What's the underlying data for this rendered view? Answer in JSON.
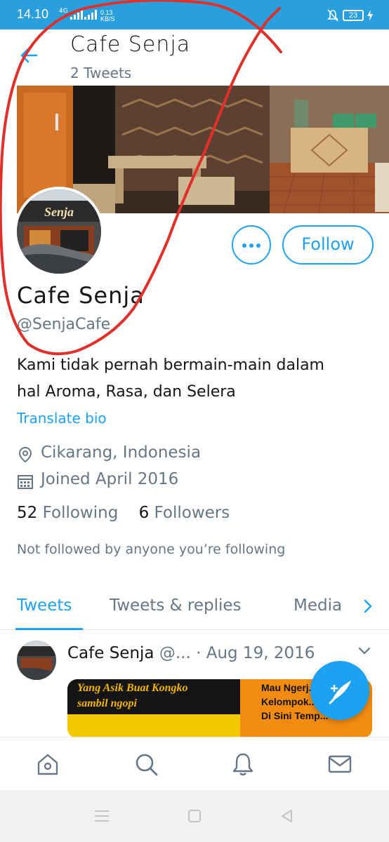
{
  "status_bar": {
    "time": "14.10",
    "network": "4G",
    "speed_value": "0.13",
    "speed_unit": "KB/S",
    "battery": "23"
  },
  "header": {
    "title": "Cafe Senja",
    "subtitle": "2 Tweets"
  },
  "profile": {
    "avatar_sign_text": "Senja",
    "follow_label": "Follow",
    "name": "Cafe Senja",
    "handle": "@SenjaCafe",
    "bio_line1": "Kami tidak pernah bermain-main dalam",
    "bio_line2": "hal Aroma, Rasa, dan Selera",
    "translate_label": "Translate bio",
    "location": "Cikarang, Indonesia",
    "joined": "Joined April 2016",
    "following_count": "52",
    "following_label": "Following",
    "followers_count": "6",
    "followers_label": "Followers",
    "not_followed_text": "Not followed by anyone you’re following"
  },
  "tabs": [
    {
      "label": "Tweets",
      "active": true
    },
    {
      "label": "Tweets & replies",
      "active": false
    },
    {
      "label": "Media",
      "active": false
    }
  ],
  "tweet": {
    "name": "Cafe Senja",
    "rest": " @... · Aug 19, 2016",
    "media_line1": "Yang Asik Buat Kongko",
    "media_line2": "sambil ngopi",
    "media_right1": "Mau Ngerj...",
    "media_right2": "Kelompok...",
    "media_right3": "Di Sini Temp..."
  },
  "icons": {
    "back": "arrow-left-icon",
    "more": "more-horizontal-icon",
    "location": "location-pin-icon",
    "calendar": "calendar-icon",
    "compose": "compose-quill-icon",
    "home": "home-icon",
    "search": "search-icon",
    "notifications": "bell-icon",
    "messages": "mail-icon"
  },
  "colors": {
    "accent": "#1da1f2",
    "status_bar": "#2a9fde",
    "secondary_text": "#657786",
    "annotation": "#e0302a"
  }
}
